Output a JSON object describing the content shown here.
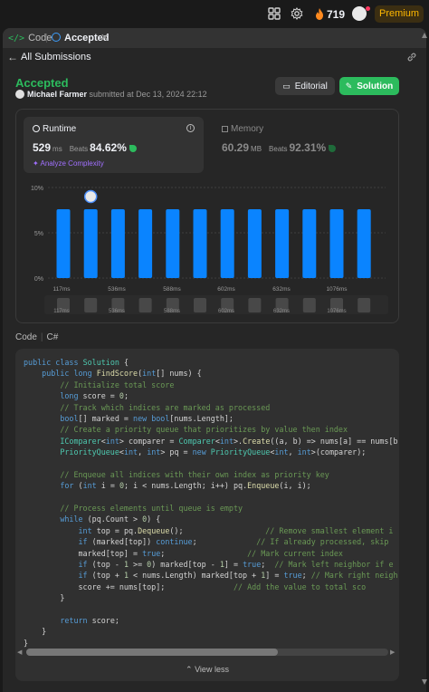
{
  "topbar": {
    "streak": "719",
    "premium_label": "Premium",
    "icons": [
      "grid-icon",
      "gear-icon",
      "fire-icon",
      "avatar"
    ]
  },
  "tabs": {
    "code_label": "Code",
    "accepted_label": "Accepted"
  },
  "subbar": {
    "all_submissions": "All Submissions"
  },
  "submission": {
    "status": "Accepted",
    "author": "Michael Farmer",
    "submitted_text": "submitted at Dec 13, 2024 22:12",
    "editorial_label": "Editorial",
    "solution_label": "Solution"
  },
  "runtime": {
    "label": "Runtime",
    "value": "529",
    "unit": "ms",
    "beats_label": "Beats",
    "beats_value": "84.62%",
    "analyze_label": "Analyze Complexity"
  },
  "memory": {
    "label": "Memory",
    "value": "60.29",
    "unit": "MB",
    "beats_label": "Beats",
    "beats_value": "92.31%"
  },
  "chart_data": {
    "type": "bar",
    "y_ticks": [
      "10%",
      "5%",
      "0%"
    ],
    "ylim": [
      0,
      10
    ],
    "values": [
      7.6,
      7.6,
      7.6,
      7.6,
      7.6,
      7.6,
      7.6,
      7.6,
      7.6,
      7.6,
      7.6,
      7.6
    ],
    "highlight_index": 1,
    "x_tick_labels": [
      "117ms",
      "536ms",
      "588ms",
      "602ms",
      "632ms",
      "1076ms"
    ],
    "accent": "#0a84ff",
    "mini_x_tick_labels": [
      "117ms",
      "536ms",
      "588ms",
      "602ms",
      "632ms",
      "1076ms"
    ]
  },
  "code_section": {
    "label": "Code",
    "language": "C#",
    "view_less": "View less",
    "lines": [
      [
        [
          "kw",
          "public class "
        ],
        [
          "ty",
          "Solution"
        ],
        [
          "pl",
          " {"
        ]
      ],
      [
        [
          "pl",
          "    "
        ],
        [
          "kw",
          "public long "
        ],
        [
          "fn",
          "FindScore"
        ],
        [
          "pl",
          "("
        ],
        [
          "kw",
          "int"
        ],
        [
          "pl",
          "[] nums) {"
        ]
      ],
      [
        [
          "cm",
          "        // Initialize total score"
        ]
      ],
      [
        [
          "pl",
          "        "
        ],
        [
          "kw",
          "long"
        ],
        [
          "pl",
          " score = "
        ],
        [
          "nm",
          "0"
        ],
        [
          "pl",
          ";"
        ]
      ],
      [
        [
          "cm",
          "        // Track which indices are marked as processed"
        ]
      ],
      [
        [
          "pl",
          "        "
        ],
        [
          "kw",
          "bool"
        ],
        [
          "pl",
          "[] marked = "
        ],
        [
          "kw",
          "new bool"
        ],
        [
          "pl",
          "[nums.Length];"
        ]
      ],
      [
        [
          "cm",
          "        // Create a priority queue that prioritizes by value then index"
        ]
      ],
      [
        [
          "pl",
          "        "
        ],
        [
          "ty",
          "IComparer"
        ],
        [
          "pl",
          "<"
        ],
        [
          "kw",
          "int"
        ],
        [
          "pl",
          "> comparer = "
        ],
        [
          "ty",
          "Comparer"
        ],
        [
          "pl",
          "<"
        ],
        [
          "kw",
          "int"
        ],
        [
          "pl",
          ">."
        ],
        [
          "fn",
          "Create"
        ],
        [
          "pl",
          "((a, b) => nums[a] == nums[b"
        ]
      ],
      [
        [
          "pl",
          "        "
        ],
        [
          "ty",
          "PriorityQueue"
        ],
        [
          "pl",
          "<"
        ],
        [
          "kw",
          "int"
        ],
        [
          "pl",
          ", "
        ],
        [
          "kw",
          "int"
        ],
        [
          "pl",
          "> pq = "
        ],
        [
          "kw",
          "new "
        ],
        [
          "ty",
          "PriorityQueue"
        ],
        [
          "pl",
          "<"
        ],
        [
          "kw",
          "int"
        ],
        [
          "pl",
          ", "
        ],
        [
          "kw",
          "int"
        ],
        [
          "pl",
          ">(comparer);"
        ]
      ],
      [
        [
          "pl",
          ""
        ]
      ],
      [
        [
          "cm",
          "        // Enqueue all indices with their own index as priority key"
        ]
      ],
      [
        [
          "pl",
          "        "
        ],
        [
          "kw",
          "for"
        ],
        [
          "pl",
          " ("
        ],
        [
          "kw",
          "int"
        ],
        [
          "pl",
          " i = "
        ],
        [
          "nm",
          "0"
        ],
        [
          "pl",
          "; i < nums.Length; i++) pq."
        ],
        [
          "fn",
          "Enqueue"
        ],
        [
          "pl",
          "(i, i);"
        ]
      ],
      [
        [
          "pl",
          ""
        ]
      ],
      [
        [
          "cm",
          "        // Process elements until queue is empty"
        ]
      ],
      [
        [
          "pl",
          "        "
        ],
        [
          "kw",
          "while"
        ],
        [
          "pl",
          " (pq.Count > "
        ],
        [
          "nm",
          "0"
        ],
        [
          "pl",
          ") {"
        ]
      ],
      [
        [
          "pl",
          "            "
        ],
        [
          "kw",
          "int"
        ],
        [
          "pl",
          " top = pq."
        ],
        [
          "fn",
          "Dequeue"
        ],
        [
          "pl",
          "();                  "
        ],
        [
          "cm",
          "// Remove smallest element i"
        ]
      ],
      [
        [
          "pl",
          "            "
        ],
        [
          "kw",
          "if"
        ],
        [
          "pl",
          " (marked[top]) "
        ],
        [
          "kw",
          "continue"
        ],
        [
          "pl",
          ";             "
        ],
        [
          "cm",
          "// If already processed, skip"
        ]
      ],
      [
        [
          "pl",
          "            marked[top] = "
        ],
        [
          "kw",
          "true"
        ],
        [
          "pl",
          ";                  "
        ],
        [
          "cm",
          "// Mark current index"
        ]
      ],
      [
        [
          "pl",
          "            "
        ],
        [
          "kw",
          "if"
        ],
        [
          "pl",
          " (top - "
        ],
        [
          "nm",
          "1"
        ],
        [
          "pl",
          " >= "
        ],
        [
          "nm",
          "0"
        ],
        [
          "pl",
          ") marked[top - "
        ],
        [
          "nm",
          "1"
        ],
        [
          "pl",
          "] = "
        ],
        [
          "kw",
          "true"
        ],
        [
          "pl",
          ";  "
        ],
        [
          "cm",
          "// Mark left neighbor if e"
        ]
      ],
      [
        [
          "pl",
          "            "
        ],
        [
          "kw",
          "if"
        ],
        [
          "pl",
          " (top + "
        ],
        [
          "nm",
          "1"
        ],
        [
          "pl",
          " < nums.Length) marked[top + "
        ],
        [
          "nm",
          "1"
        ],
        [
          "pl",
          "] = "
        ],
        [
          "kw",
          "true"
        ],
        [
          "pl",
          "; "
        ],
        [
          "cm",
          "// Mark right neigh"
        ]
      ],
      [
        [
          "pl",
          "            score += nums[top];               "
        ],
        [
          "cm",
          "// Add the value to total sco"
        ]
      ],
      [
        [
          "pl",
          "        }"
        ]
      ],
      [
        [
          "pl",
          ""
        ]
      ],
      [
        [
          "pl",
          "        "
        ],
        [
          "kw",
          "return"
        ],
        [
          "pl",
          " score;"
        ]
      ],
      [
        [
          "pl",
          "    }"
        ]
      ],
      [
        [
          "pl",
          "}"
        ]
      ]
    ]
  }
}
